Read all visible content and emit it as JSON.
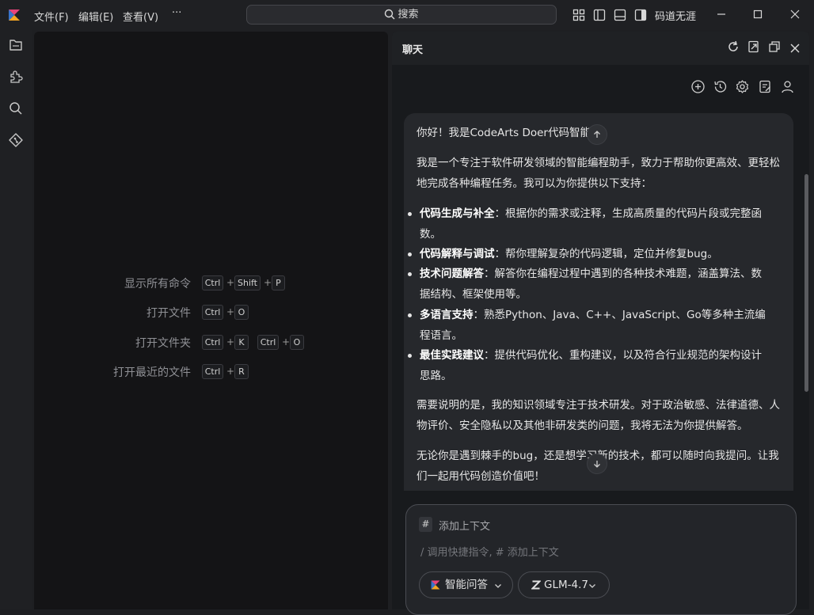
{
  "menu": {
    "file": "文件(F)",
    "edit": "编辑(E)",
    "view": "查看(V)",
    "more": "···"
  },
  "search": {
    "label": "搜索"
  },
  "user": {
    "name": "码道无涯"
  },
  "shortcuts": [
    {
      "label": "显示所有命令",
      "keys": [
        "Ctrl",
        "Shift",
        "P"
      ]
    },
    {
      "label": "打开文件",
      "keys": [
        "Ctrl",
        "O"
      ]
    },
    {
      "label": "打开文件夹",
      "keys": [
        "Ctrl",
        "K",
        "Ctrl",
        "O"
      ]
    },
    {
      "label": "打开最近的文件",
      "keys": [
        "Ctrl",
        "R"
      ]
    }
  ],
  "chat": {
    "title": "聊天",
    "greeting": "你好！我是CodeArts Doer代码智能体。",
    "intro": "我是一个专注于软件研发领域的智能编程助手，致力于帮助你更高效、更轻松地完成各种编程任务。我可以为你提供以下支持：",
    "features": [
      {
        "title": "代码生成与补全",
        "desc": "：根据你的需求或注释，生成高质量的代码片段或完整函数。"
      },
      {
        "title": "代码解释与调试",
        "desc": "：帮你理解复杂的代码逻辑，定位并修复bug。"
      },
      {
        "title": "技术问题解答",
        "desc": "：解答你在编程过程中遇到的各种技术难题，涵盖算法、数据结构、框架使用等。"
      },
      {
        "title": "多语言支持",
        "desc": "：熟悉Python、Java、C++、JavaScript、Go等多种主流编程语言。"
      },
      {
        "title": "最佳实践建议",
        "desc": "：提供代码优化、重构建议，以及符合行业规范的架构设计思路。"
      }
    ],
    "note": "需要说明的是，我的知识领域专注于技术研发。对于政治敏感、法律道德、人物评价、安全隐私以及其他非研发类的问题，我将无法为你提供解答。",
    "closing": "无论你是遇到棘手的bug，还是想学习新的技术，都可以随时向我提问。让我们一起用代码创造价值吧！"
  },
  "input": {
    "hash": "#",
    "add_context": "添加上下文",
    "placeholder": "/ 调用快捷指令, # 添加上下文",
    "mode": "智能问答",
    "model": "GLM-4.7"
  },
  "colors": {
    "accent_pink": "#e8437a",
    "accent_orange": "#f5a623",
    "accent_blue": "#3b7ddd"
  }
}
